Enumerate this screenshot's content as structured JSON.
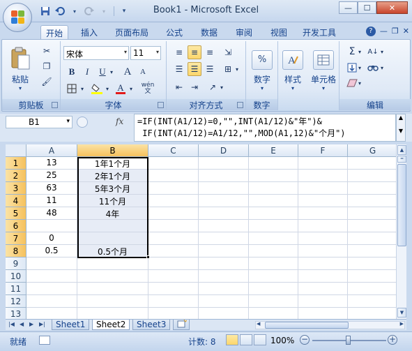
{
  "window": {
    "title": "Book1 - Microsoft Excel"
  },
  "quick_access": {
    "save_icon": "save-icon",
    "undo_icon": "undo-icon",
    "redo_icon": "redo-icon",
    "customize_icon": "dropdown-icon"
  },
  "tabs": [
    "开始",
    "插入",
    "页面布局",
    "公式",
    "数据",
    "审阅",
    "视图",
    "开发工具"
  ],
  "active_tab": "开始",
  "ribbon": {
    "clipboard": {
      "label": "剪贴板",
      "paste": "粘贴"
    },
    "font": {
      "label": "字体",
      "name": "宋体",
      "size": "11",
      "bold": "B",
      "italic": "I",
      "underline": "U",
      "grow": "A",
      "shrink": "A",
      "phonetic": "wén"
    },
    "alignment": {
      "label": "对齐方式"
    },
    "number": {
      "label": "数字",
      "button": "数字",
      "icon_text": "%"
    },
    "styles": {
      "button": "样式"
    },
    "cells": {
      "button": "单元格"
    },
    "editing": {
      "label": "编辑"
    }
  },
  "formula_bar": {
    "name_box": "B1",
    "fx": "fx",
    "formula_line1": "=IF(INT(A1/12)=0,\"\",INT(A1/12)&\"年\")&",
    "formula_line2": " IF(INT(A1/12)=A1/12,\"\",MOD(A1,12)&\"个月\")"
  },
  "grid": {
    "columns": [
      "A",
      "B",
      "C",
      "D",
      "E",
      "F",
      "G"
    ],
    "selected_column": "B",
    "rows": [
      {
        "num": "1",
        "a": "13",
        "b": "1年1个月"
      },
      {
        "num": "2",
        "a": "25",
        "b": "2年1个月"
      },
      {
        "num": "3",
        "a": "63",
        "b": "5年3个月"
      },
      {
        "num": "4",
        "a": "11",
        "b": "11个月"
      },
      {
        "num": "5",
        "a": "48",
        "b": "4年"
      },
      {
        "num": "6",
        "a": "",
        "b": ""
      },
      {
        "num": "7",
        "a": "0",
        "b": ""
      },
      {
        "num": "8",
        "a": "0.5",
        "b": "0.5个月"
      },
      {
        "num": "9",
        "a": "",
        "b": ""
      },
      {
        "num": "10",
        "a": "",
        "b": ""
      },
      {
        "num": "11",
        "a": "",
        "b": ""
      },
      {
        "num": "12",
        "a": "",
        "b": ""
      },
      {
        "num": "13",
        "a": "",
        "b": ""
      }
    ]
  },
  "sheets": [
    "Sheet1",
    "Sheet2",
    "Sheet3"
  ],
  "active_sheet": "Sheet2",
  "status": {
    "ready": "就绪",
    "count": "计数: 8",
    "zoom": "100%"
  },
  "colors": {
    "accent": "#15428b",
    "selection_header": "#f6c15d",
    "selected_fill": "#e7ecf6"
  }
}
